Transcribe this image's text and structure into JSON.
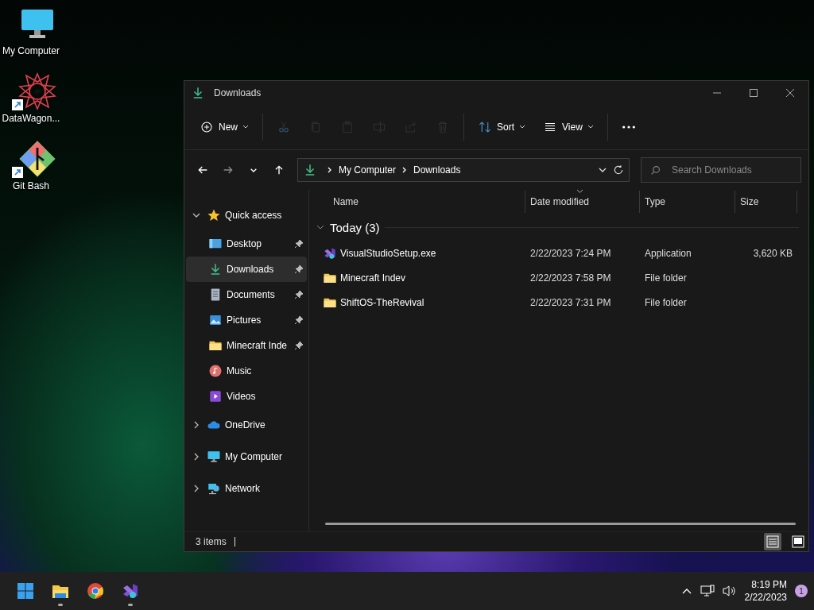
{
  "desktop_icons": [
    {
      "label": "My Computer",
      "kind": "monitor",
      "shortcut": false
    },
    {
      "label": "DataWagon...",
      "kind": "star",
      "shortcut": true
    },
    {
      "label": "Git Bash",
      "kind": "git",
      "shortcut": true
    }
  ],
  "window": {
    "title": "Downloads",
    "toolbar": [
      {
        "kind": "new",
        "label": "New",
        "disabled": false
      },
      {
        "kind": "cut",
        "disabled": true
      },
      {
        "kind": "copy",
        "disabled": true
      },
      {
        "kind": "paste",
        "disabled": true
      },
      {
        "kind": "rename",
        "disabled": true
      },
      {
        "kind": "share",
        "disabled": true
      },
      {
        "kind": "delete",
        "disabled": true
      },
      {
        "kind": "sort",
        "label": "Sort",
        "disabled": false
      },
      {
        "kind": "view",
        "label": "View",
        "disabled": false
      },
      {
        "kind": "more",
        "disabled": false
      }
    ],
    "nav_buttons": [
      {
        "kind": "back",
        "disabled": false
      },
      {
        "kind": "forward",
        "disabled": true
      },
      {
        "kind": "recent",
        "disabled": false
      },
      {
        "kind": "up",
        "disabled": false
      }
    ],
    "breadcrumb": [
      "My Computer",
      "Downloads"
    ],
    "search": {
      "placeholder": "Search Downloads"
    },
    "sidebar": {
      "items": [
        {
          "label": "Quick access",
          "kind": "star",
          "expanded": true,
          "selected": false,
          "children": [
            {
              "label": "Desktop",
              "kind": "desktop",
              "pinned": true,
              "selected": false
            },
            {
              "label": "Downloads",
              "kind": "download",
              "pinned": true,
              "selected": true
            },
            {
              "label": "Documents",
              "kind": "document",
              "pinned": true,
              "selected": false
            },
            {
              "label": "Pictures",
              "kind": "picture",
              "pinned": true,
              "selected": false
            },
            {
              "label": "Minecraft Inde",
              "kind": "folder",
              "pinned": true,
              "selected": false
            },
            {
              "label": "Music",
              "kind": "music",
              "pinned": false,
              "selected": false
            },
            {
              "label": "Videos",
              "kind": "video",
              "pinned": false,
              "selected": false
            }
          ]
        },
        {
          "label": "OneDrive",
          "kind": "cloud",
          "expanded": false,
          "selected": false
        },
        {
          "label": "My Computer",
          "kind": "monitor",
          "expanded": false,
          "selected": false
        },
        {
          "label": "Network",
          "kind": "network",
          "expanded": false,
          "selected": false
        }
      ]
    },
    "columns": [
      {
        "label": "Name",
        "sorted": false
      },
      {
        "label": "Date modified",
        "sorted": true
      },
      {
        "label": "Type",
        "sorted": false
      },
      {
        "label": "Size",
        "sorted": false
      }
    ],
    "groups": [
      {
        "label": "Today (3)",
        "expanded": true,
        "rows": [
          {
            "kind": "app",
            "name": "VisualStudioSetup.exe",
            "date": "2/22/2023 7:24 PM",
            "type": "Application",
            "size": "3,620 KB"
          },
          {
            "kind": "folder",
            "name": "Minecraft Indev",
            "date": "2/22/2023 7:58 PM",
            "type": "File folder"
          },
          {
            "kind": "folder",
            "name": "ShiftOS-TheRevival",
            "date": "2/22/2023 7:31 PM",
            "type": "File folder"
          }
        ]
      }
    ],
    "status_bar": {
      "text": "3 items",
      "views": [
        {
          "kind": "details",
          "selected": true
        },
        {
          "kind": "tiles",
          "selected": false
        }
      ]
    }
  },
  "taskbar": {
    "apps": [
      {
        "kind": "start",
        "running": false
      },
      {
        "kind": "explorer",
        "running": true
      },
      {
        "kind": "chrome",
        "running": false
      },
      {
        "kind": "vs",
        "running": true
      }
    ],
    "clock": {
      "time": "8:19 PM",
      "date": "2/22/2023"
    },
    "notification_count": "1"
  }
}
